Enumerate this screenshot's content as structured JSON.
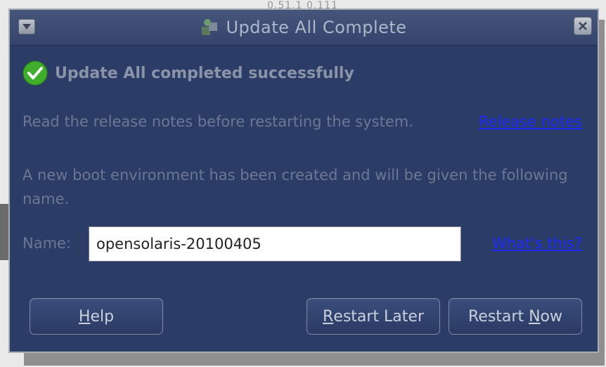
{
  "background": {
    "peek_text": "0.51.1 0.111"
  },
  "window": {
    "title": "Update All Complete",
    "icons": {
      "menu": "window-menu-icon",
      "close": "close-icon",
      "app": "package-manager-icon",
      "status": "check-icon"
    }
  },
  "content": {
    "success_message": "Update All completed successfully",
    "notes_text": "Read the release notes before restarting the system.",
    "release_notes_link": "Release notes",
    "be_text": "A new boot environment has been created and will be given the following name.",
    "name_label": "Name:",
    "name_value": "opensolaris-20100405",
    "whats_this_link": "What's this?"
  },
  "buttons": {
    "help": {
      "mnemonic": "H",
      "rest": "elp"
    },
    "restart_later": {
      "mnemonic": "R",
      "rest": "estart Later"
    },
    "restart_now": {
      "prefix": "Restart ",
      "mnemonic": "N",
      "rest": "ow"
    }
  },
  "colors": {
    "window_bg": "#2b3c66",
    "link": "#1d2bff",
    "check_green": "#3fae2a"
  }
}
